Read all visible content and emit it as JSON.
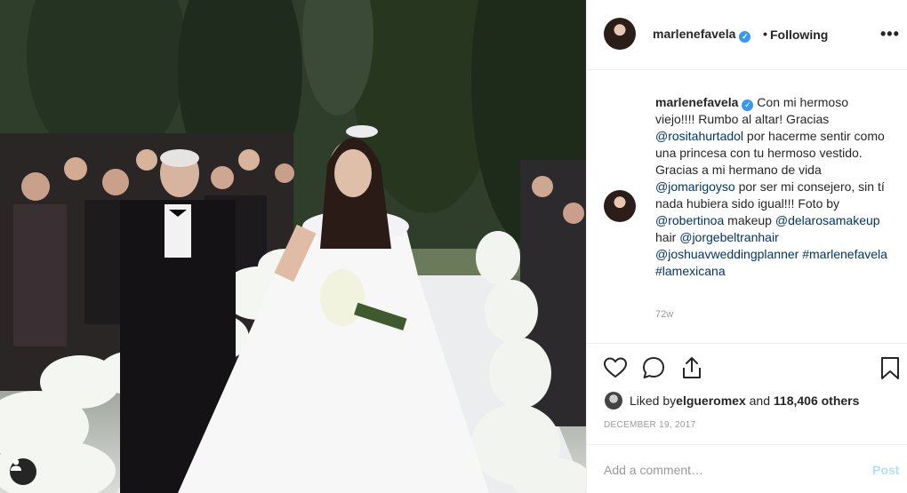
{
  "post": {
    "username": "marlenefavela",
    "follow_status": "Following",
    "more_icon": "more-options-icon"
  },
  "caption": {
    "username": "marlenefavela",
    "part1": "Con mi hermoso viejo!!!! Rumbo al altar! Gracias ",
    "mention1": "@rositahurtadol",
    "part2": " por hacerme sentir como una princesa con tu hermoso vestido. Gracias a mi hermano de vida ",
    "mention2": "@jomarigoyso",
    "part3": " por ser mi consejero, sin tí nada hubiera sido igual!!! Foto by ",
    "mention3": "@robertinoa",
    "part4": " makeup ",
    "mention4": "@delarosamakeup",
    "part5": " hair ",
    "mention5": "@jorgebeltranhair",
    "part6": " ",
    "mention6": "@joshuavweddingplanner",
    "part7": " ",
    "hashtag1": "#marlenefavela",
    "part8": " ",
    "hashtag2": "#lamexicana",
    "time_ago": "72w"
  },
  "actions": {
    "like_icon": "heart-icon",
    "comment_icon": "comment-icon",
    "share_icon": "share-icon",
    "save_icon": "bookmark-icon"
  },
  "likes": {
    "prefix": "Liked by ",
    "liker": "elgueromex",
    "middle": " and ",
    "count": "118,406 others"
  },
  "date": "DECEMBER 19, 2017",
  "add_comment": {
    "placeholder": "Add a comment…",
    "post_label": "Post"
  },
  "colors": {
    "link": "#003569",
    "verified": "#3897f0",
    "post_disabled": "#b2dffc",
    "muted": "#999999"
  }
}
